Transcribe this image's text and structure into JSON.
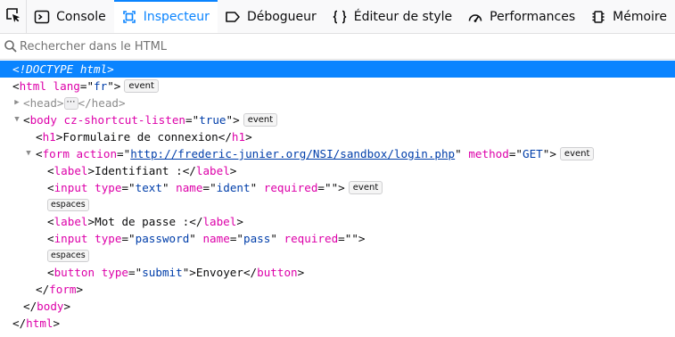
{
  "toolbar": {
    "tabs": [
      {
        "label": "Console",
        "icon": "console-icon"
      },
      {
        "label": "Inspecteur",
        "icon": "inspector-icon",
        "selected": true
      },
      {
        "label": "Débogueur",
        "icon": "debugger-icon"
      },
      {
        "label": "Éditeur de style",
        "icon": "style-editor-icon"
      },
      {
        "label": "Performances",
        "icon": "performance-icon"
      },
      {
        "label": "Mémoire",
        "icon": "memory-icon"
      }
    ],
    "accent": "#0a84ff"
  },
  "search": {
    "placeholder": "Rechercher dans le HTML"
  },
  "markup": {
    "doctype": "<!DOCTYPE html>",
    "html_open_tag": "html",
    "html_lang_attr": "lang",
    "html_lang_val": "fr",
    "head_open": "<head>",
    "head_close": "</head>",
    "ellipsis": "⋯",
    "body_tag": "body",
    "body_attr": "cz-shortcut-listen",
    "body_val": "true",
    "h1_tag": "h1",
    "h1_text": "Formulaire de connexion",
    "form_tag": "form",
    "form_action_attr": "action",
    "form_action_val": "http://frederic-junier.org/NSI/sandbox/login.php",
    "form_method_attr": "method",
    "form_method_val": "GET",
    "label_tag": "label",
    "label1_text": "Identifiant :",
    "input_tag": "input",
    "type_attr": "type",
    "name_attr": "name",
    "required_attr": "required",
    "input1_type": "text",
    "input1_name": "ident",
    "empty_val": "",
    "label2_text": "Mot de passe :",
    "input2_type": "password",
    "input2_name": "pass",
    "button_tag": "button",
    "button_type": "submit",
    "button_text": "Envoyer",
    "event_badge": "event",
    "whitespace_badge": "espaces"
  }
}
